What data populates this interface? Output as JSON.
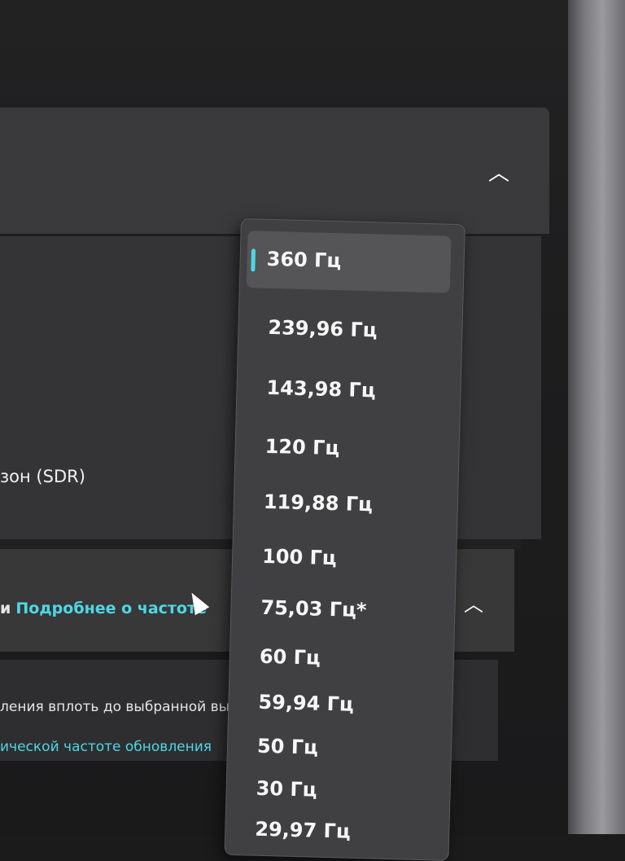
{
  "display": {
    "mode_label": "зон (SDR)"
  },
  "refresh_section": {
    "bullet": "и",
    "learn_more_link": "Подробнее о частоте"
  },
  "dynamic_refresh": {
    "description": "ления вплоть до выбранной вы",
    "link": "ической частоте обновления"
  },
  "refresh_dropdown": {
    "selected_value": "360 Гц",
    "options": [
      {
        "label": "360 Гц"
      },
      {
        "label": "239,96 Гц"
      },
      {
        "label": "143,98 Гц"
      },
      {
        "label": "120 Гц"
      },
      {
        "label": "119,88 Гц"
      },
      {
        "label": "100 Гц"
      },
      {
        "label": "75,03 Гц*"
      },
      {
        "label": "60 Гц"
      },
      {
        "label": "59,94 Гц"
      },
      {
        "label": "50 Гц"
      },
      {
        "label": "30 Гц"
      },
      {
        "label": "29,97 Гц"
      }
    ]
  },
  "icons": {
    "card_top_chevron": "chevron-up-icon",
    "refresh_chevron": "chevron-up-icon",
    "side_chevron": "chevron-right-icon",
    "cursor": "mouse-pointer-icon"
  },
  "colors": {
    "accent": "#4fd7e6",
    "dropdown_bg": "#404042",
    "selected_bg": "#555557"
  }
}
